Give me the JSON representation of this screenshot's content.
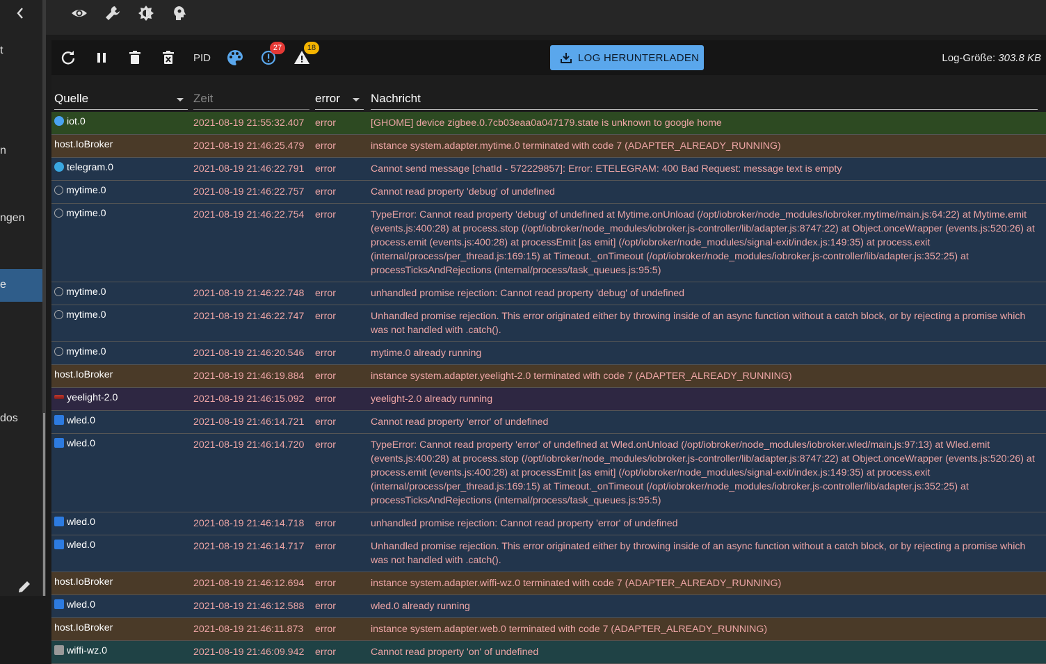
{
  "drawer": {
    "fragments": [
      "t",
      "n",
      "ngen",
      "e",
      "dos"
    ]
  },
  "appbar": {
    "icons": [
      "eye-icon",
      "wrench-icon",
      "brightness-icon",
      "expert-head-icon"
    ]
  },
  "toolbar": {
    "pid_label": "PID",
    "errors_badge": "27",
    "warnings_badge": "18",
    "download_label": "LOG HERUNTERLADEN",
    "size_label": "Log-Größe:",
    "size_value": "303.8 KB"
  },
  "filters": {
    "source": "Quelle",
    "time_placeholder": "Zeit",
    "severity": "error",
    "message": "Nachricht"
  },
  "colors": {
    "host": "#4a3a28",
    "default": "#22354c",
    "iot": "#2d4a22",
    "yeelight": "#2e2742",
    "wiffi": "#1f4245",
    "error_text": "#eda5a5",
    "button": "#5aa7ec"
  },
  "rows": [
    {
      "source": "iot.0",
      "icon": "cloud-icon",
      "time": "2021-08-19 21:55:32.407",
      "severity": "error",
      "message": "[GHOME] device zigbee.0.7cb03eaa0a047179.state is unknown to google home",
      "tone": "green"
    },
    {
      "source": "host.IoBroker",
      "icon": "",
      "time": "2021-08-19 21:46:25.479",
      "severity": "error",
      "message": "instance system.adapter.mytime.0 terminated with code 7 (ADAPTER_ALREADY_RUNNING)",
      "tone": "host"
    },
    {
      "source": "telegram.0",
      "icon": "telegram-icon",
      "time": "2021-08-19 21:46:22.791",
      "severity": "error",
      "message": "Cannot send message [chatId - 572229857]: Error: ETELEGRAM: 400 Bad Request: message text is empty",
      "tone": "blue"
    },
    {
      "source": "mytime.0",
      "icon": "clock-icon",
      "time": "2021-08-19 21:46:22.757",
      "severity": "error",
      "message": "Cannot read property 'debug' of undefined",
      "tone": "blue"
    },
    {
      "source": "mytime.0",
      "icon": "clock-icon",
      "time": "2021-08-19 21:46:22.754",
      "severity": "error",
      "message": "TypeError: Cannot read property 'debug' of undefined at Mytime.onUnload (/opt/iobroker/node_modules/iobroker.mytime/main.js:64:22) at Mytime.emit (events.js:400:28) at process.stop (/opt/iobroker/node_modules/iobroker.js-controller/lib/adapter.js:8747:22) at Object.onceWrapper (events.js:520:26) at process.emit (events.js:400:28) at processEmit [as emit] (/opt/iobroker/node_modules/signal-exit/index.js:149:35) at process.exit (internal/process/per_thread.js:169:15) at Timeout._onTimeout (/opt/iobroker/node_modules/iobroker.js-controller/lib/adapter.js:352:25) at processTicksAndRejections (internal/process/task_queues.js:95:5)",
      "tone": "blue"
    },
    {
      "source": "mytime.0",
      "icon": "clock-icon",
      "time": "2021-08-19 21:46:22.748",
      "severity": "error",
      "message": "unhandled promise rejection: Cannot read property 'debug' of undefined",
      "tone": "blue"
    },
    {
      "source": "mytime.0",
      "icon": "clock-icon",
      "time": "2021-08-19 21:46:22.747",
      "severity": "error",
      "message": "Unhandled promise rejection. This error originated either by throwing inside of an async function without a catch block, or by rejecting a promise which was not handled with .catch().",
      "tone": "blue"
    },
    {
      "source": "mytime.0",
      "icon": "clock-icon",
      "time": "2021-08-19 21:46:20.546",
      "severity": "error",
      "message": "mytime.0 already running",
      "tone": "blue"
    },
    {
      "source": "host.IoBroker",
      "icon": "",
      "time": "2021-08-19 21:46:19.884",
      "severity": "error",
      "message": "instance system.adapter.yeelight-2.0 terminated with code 7 (ADAPTER_ALREADY_RUNNING)",
      "tone": "host"
    },
    {
      "source": "yeelight-2.0",
      "icon": "lamp-icon",
      "time": "2021-08-19 21:46:15.092",
      "severity": "error",
      "message": "yeelight-2.0 already running",
      "tone": "purple"
    },
    {
      "source": "wled.0",
      "icon": "wled-icon",
      "time": "2021-08-19 21:46:14.721",
      "severity": "error",
      "message": "Cannot read property 'error' of undefined",
      "tone": "blue"
    },
    {
      "source": "wled.0",
      "icon": "wled-icon",
      "time": "2021-08-19 21:46:14.720",
      "severity": "error",
      "message": "TypeError: Cannot read property 'error' of undefined at Wled.onUnload (/opt/iobroker/node_modules/iobroker.wled/main.js:97:13) at Wled.emit (events.js:400:28) at process.stop (/opt/iobroker/node_modules/iobroker.js-controller/lib/adapter.js:8747:22) at Object.onceWrapper (events.js:520:26) at process.emit (events.js:400:28) at processEmit [as emit] (/opt/iobroker/node_modules/signal-exit/index.js:149:35) at process.exit (internal/process/per_thread.js:169:15) at Timeout._onTimeout (/opt/iobroker/node_modules/iobroker.js-controller/lib/adapter.js:352:25) at processTicksAndRejections (internal/process/task_queues.js:95:5)",
      "tone": "blue"
    },
    {
      "source": "wled.0",
      "icon": "wled-icon",
      "time": "2021-08-19 21:46:14.718",
      "severity": "error",
      "message": "unhandled promise rejection: Cannot read property 'error' of undefined",
      "tone": "blue"
    },
    {
      "source": "wled.0",
      "icon": "wled-icon",
      "time": "2021-08-19 21:46:14.717",
      "severity": "error",
      "message": "Unhandled promise rejection. This error originated either by throwing inside of an async function without a catch block, or by rejecting a promise which was not handled with .catch().",
      "tone": "blue"
    },
    {
      "source": "host.IoBroker",
      "icon": "",
      "time": "2021-08-19 21:46:12.694",
      "severity": "error",
      "message": "instance system.adapter.wiffi-wz.0 terminated with code 7 (ADAPTER_ALREADY_RUNNING)",
      "tone": "host"
    },
    {
      "source": "wled.0",
      "icon": "wled-icon",
      "time": "2021-08-19 21:46:12.588",
      "severity": "error",
      "message": "wled.0 already running",
      "tone": "blue"
    },
    {
      "source": "host.IoBroker",
      "icon": "",
      "time": "2021-08-19 21:46:11.873",
      "severity": "error",
      "message": "instance system.adapter.web.0 terminated with code 7 (ADAPTER_ALREADY_RUNNING)",
      "tone": "host"
    },
    {
      "source": "wiffi-wz.0",
      "icon": "wiffi-icon",
      "time": "2021-08-19 21:46:09.942",
      "severity": "error",
      "message": "Cannot read property 'on' of undefined",
      "tone": "teal"
    }
  ]
}
